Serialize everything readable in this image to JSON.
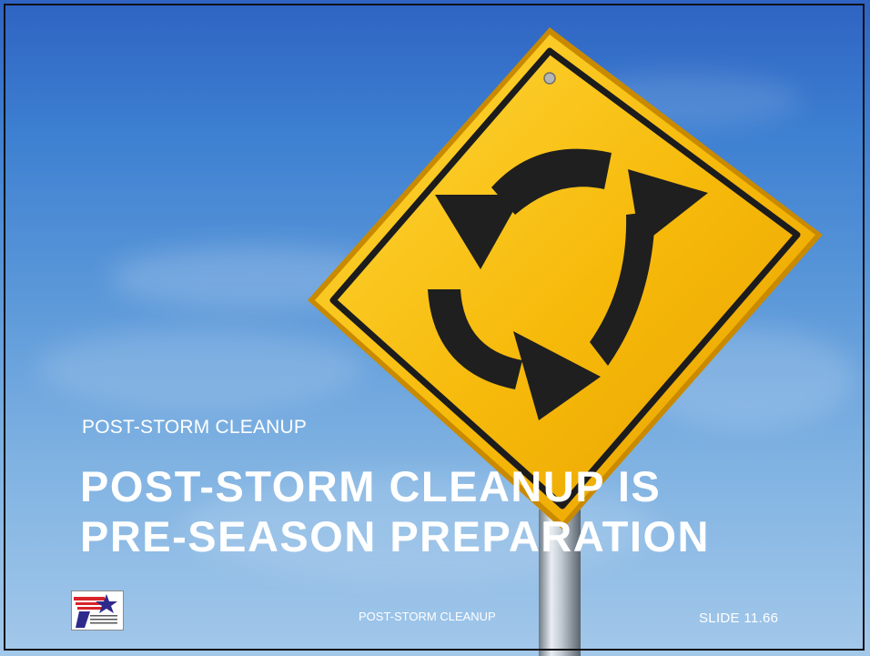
{
  "slide": {
    "kicker": "POST-STORM CLEANUP",
    "title_line1": "POST-STORM CLEANUP IS",
    "title_line2": "PRE-SEASON PREPARATION",
    "footer_center": "POST-STORM CLEANUP",
    "footer_right": "SLIDE 11.66",
    "logo": {
      "name": "txdot-logo-icon",
      "text": "Texas Department of Transportation"
    },
    "sign": {
      "name": "roundabout-warning-sign-icon"
    }
  },
  "colors": {
    "sky_top": "#2e63c2",
    "sky_bottom": "#a3c8ea",
    "sign_yellow": "#f5b800",
    "sign_border": "#1c1c1c",
    "text": "#ffffff"
  }
}
